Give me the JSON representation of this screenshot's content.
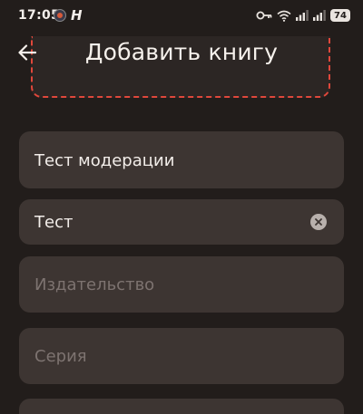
{
  "status_bar": {
    "time": "17:05",
    "app_letter": "H",
    "battery": "74"
  },
  "app_bar": {
    "title": "Добавить книгу"
  },
  "form": {
    "title_field": {
      "value": "Тест модерации"
    },
    "author_field": {
      "value": "Тест"
    },
    "publisher_field": {
      "placeholder": "Издательство"
    },
    "series_field": {
      "placeholder": "Серия"
    }
  },
  "colors": {
    "background": "#221d1b",
    "field": "#3d3532",
    "dashed_border": "#e0473b"
  }
}
